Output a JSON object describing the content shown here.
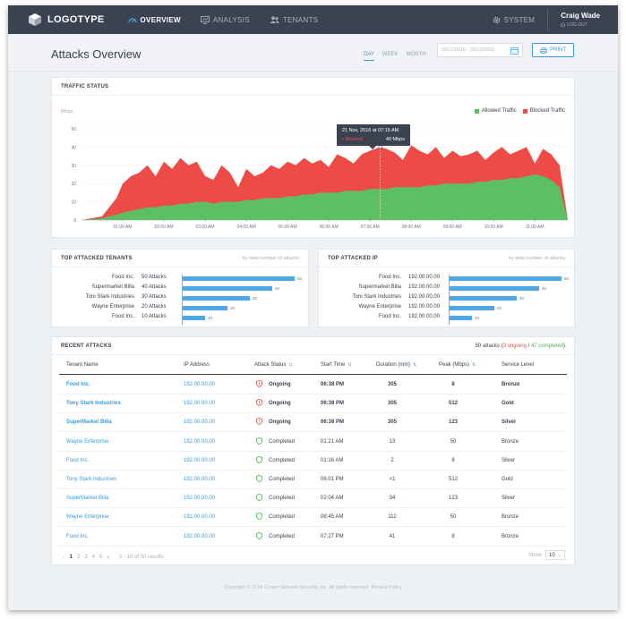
{
  "topbar": {
    "logo": "LOGOTYPE",
    "nav": [
      {
        "label": "OVERVIEW",
        "icon": "gauge-icon",
        "active": true
      },
      {
        "label": "ANALYSIS",
        "icon": "monitor-chart-icon",
        "active": false
      },
      {
        "label": "TENANTS",
        "icon": "users-icon",
        "active": false
      }
    ],
    "system": "SYSTEM",
    "user_name": "Craig Wade",
    "logout": "LOG OUT"
  },
  "header": {
    "title": "Attacks Overview",
    "ranges": [
      "DAY",
      "WEEK",
      "MONTH"
    ],
    "active_range": "DAY",
    "date_range": "28/11/2016 - 28/12/2016",
    "print": "PRINT"
  },
  "traffic": {
    "title": "TRAFFIC STATUS",
    "unit": "Mbps",
    "legend": [
      "Allowed Traffic",
      "Blocked Traffic"
    ],
    "tooltip_time": "21 Nov, 2016 at 07:15 AM",
    "tooltip_series": "• Blocked",
    "tooltip_value": "40 Mbps"
  },
  "chart_data": {
    "type": "area",
    "ylabel": "Mbps",
    "ylim": [
      0,
      50
    ],
    "yticks": [
      "50",
      "40",
      "30",
      "20",
      "10",
      "0"
    ],
    "x_ticks": [
      "01:00 AM",
      "02:00 AM",
      "03:00 AM",
      "04:00 AM",
      "05:00 AM",
      "06:00 AM",
      "07:00 AM",
      "08:00 AM",
      "09:00 AM",
      "10:00 AM",
      "11:00 AM"
    ],
    "legend_position": "top-right",
    "colors": {
      "allowed": "#5cbf62",
      "blocked": "#ee4b46"
    },
    "x_hours": [
      0.0,
      0.5,
      0.85,
      1.0,
      1.2,
      1.4,
      1.6,
      1.8,
      2.0,
      2.2,
      2.4,
      2.6,
      2.8,
      3.0,
      3.2,
      3.4,
      3.6,
      3.8,
      4.0,
      4.2,
      4.4,
      4.6,
      4.8,
      5.0,
      5.2,
      5.4,
      5.6,
      5.8,
      6.0,
      6.2,
      6.4,
      6.6,
      6.8,
      7.0,
      7.25,
      7.4,
      7.6,
      7.8,
      8.0,
      8.2,
      8.4,
      8.6,
      8.8,
      9.0,
      9.2,
      9.4,
      9.6,
      9.8,
      10.0,
      10.2,
      10.4,
      10.6,
      10.8,
      11.0,
      11.2,
      11.4,
      11.6,
      11.8
    ],
    "series": [
      {
        "name": "Blocked Traffic",
        "values": [
          0,
          2,
          12,
          20,
          24,
          26,
          30,
          24,
          32,
          28,
          34,
          30,
          32,
          24,
          22,
          30,
          26,
          18,
          28,
          24,
          26,
          30,
          28,
          32,
          30,
          34,
          31,
          33,
          29,
          36,
          34,
          31,
          36,
          38,
          40,
          39,
          37,
          33,
          41,
          38,
          36,
          40,
          34,
          38,
          35,
          36,
          38,
          33,
          37,
          40,
          36,
          38,
          40,
          31,
          39,
          36,
          30,
          0
        ]
      },
      {
        "name": "Allowed Traffic",
        "values": [
          0,
          1,
          3,
          4,
          5,
          6,
          7,
          7,
          8,
          8,
          9,
          9,
          10,
          10,
          9,
          10,
          10,
          10,
          11,
          11,
          12,
          12,
          12,
          13,
          13,
          14,
          14,
          15,
          15,
          15,
          16,
          16,
          16,
          17,
          17,
          17,
          18,
          18,
          18,
          18,
          19,
          19,
          20,
          20,
          20,
          20,
          21,
          21,
          22,
          22,
          23,
          23,
          24,
          25,
          24,
          22,
          18,
          0
        ]
      }
    ]
  },
  "tenants": {
    "title": "TOP ATTACKED TENANTS",
    "sub": "by total number of attacks",
    "rows": [
      {
        "name": "Food Inc.",
        "count": "50 Attacks",
        "value": 50
      },
      {
        "name": "Supermarket Billa",
        "count": "40 Attacks",
        "value": 40
      },
      {
        "name": "Toni Stark Industries",
        "count": "30 Attacks",
        "value": 30
      },
      {
        "name": "Wayne Enterprise",
        "count": "20 Attacks",
        "value": 20
      },
      {
        "name": "Food Inc.",
        "count": "10 Attacks",
        "value": 10
      }
    ]
  },
  "ips": {
    "title": "TOP ATTACKED IP",
    "sub": "by total number of attacks",
    "rows": [
      {
        "name": "Food Inc.",
        "count": "192.00.00.00",
        "value": 50
      },
      {
        "name": "Supermarket Billa",
        "count": "192.00.00.00",
        "value": 40
      },
      {
        "name": "Toni Stark Industries",
        "count": "192.00.00.00",
        "value": 30
      },
      {
        "name": "Wayne Enterprise",
        "count": "192.00.00.00",
        "value": 20
      },
      {
        "name": "Food Inc.",
        "count": "192.00.00.00",
        "value": 10
      }
    ]
  },
  "recent": {
    "title": "RECENT ATTACKS",
    "summary_total": "50 attacks (",
    "summary_ongoing": "3 ongoing",
    "summary_sep": " / ",
    "summary_completed": "47 completed",
    "summary_end": ")",
    "columns": [
      "Tenant Name",
      "IP Address",
      "Attack Status",
      "Start Time",
      "Duration (min)",
      "Peak (Mbps)",
      "Service Level"
    ],
    "rows": [
      {
        "tenant": "Food Inc.",
        "ip": "192.00.00.00",
        "status": "Ongoing",
        "start": "06:38 PM",
        "duration": "305",
        "peak": "8",
        "level": "Bronze"
      },
      {
        "tenant": "Tony Stark Industries",
        "ip": "192.00.00.00",
        "status": "Ongoing",
        "start": "06:38 PM",
        "duration": "305",
        "peak": "512",
        "level": "Gold"
      },
      {
        "tenant": "SuperMarket Billa",
        "ip": "192.00.00.00",
        "status": "Ongoing",
        "start": "06:38 PM",
        "duration": "305",
        "peak": "123",
        "level": "Silver"
      },
      {
        "tenant": "Wayne Enterprise",
        "ip": "192.00.00.00",
        "status": "Completed",
        "start": "01:21 AM",
        "duration": "13",
        "peak": "50",
        "level": "Bronze"
      },
      {
        "tenant": "Food Inc.",
        "ip": "192.00.00.00",
        "status": "Completed",
        "start": "01:16 AM",
        "duration": "2",
        "peak": "8",
        "level": "Silver"
      },
      {
        "tenant": "Tony Stark Industries",
        "ip": "192.00.00.00",
        "status": "Completed",
        "start": "06:01 PM",
        "duration": "<1",
        "peak": "512",
        "level": "Gold"
      },
      {
        "tenant": "SuperMarket Billa",
        "ip": "192.00.00.00",
        "status": "Completed",
        "start": "02:04 AM",
        "duration": "34",
        "peak": "123",
        "level": "Silver"
      },
      {
        "tenant": "Wayne Enterprise",
        "ip": "192.00.00.00",
        "status": "Completed",
        "start": "08:45 AM",
        "duration": "112",
        "peak": "50",
        "level": "Bronze"
      },
      {
        "tenant": "Food Inc.",
        "ip": "192.00.00.00",
        "status": "Completed",
        "start": "07:27 PM",
        "duration": "41",
        "peak": "8",
        "level": "Bronze"
      }
    ],
    "pages": [
      "1",
      "2",
      "3",
      "4",
      "5"
    ],
    "results": "1 - 10 of 50 results",
    "show_label": "Show",
    "show_value": "10"
  },
  "footer": "Copyright © 2016 Corero Network Security, Inc. All rights reserved. Privacy Policy"
}
